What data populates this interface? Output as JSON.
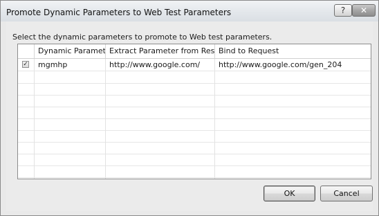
{
  "window": {
    "title": "Promote Dynamic Parameters to Web Test Parameters",
    "help_icon": "?",
    "close_icon": "✕"
  },
  "instruction": "Select the dynamic parameters to promote to Web test parameters.",
  "grid": {
    "columns": [
      "",
      "Dynamic Parameter",
      "Extract Parameter from Respo...",
      "Bind to Request"
    ],
    "rows": [
      {
        "checked": true,
        "check_glyph": "✓",
        "dynamic_parameter": "mgmhp",
        "extract_from": "http://www.google.com/",
        "bind_to": "http://www.google.com/gen_204"
      }
    ],
    "empty_row_count": 10
  },
  "buttons": {
    "ok": "OK",
    "cancel": "Cancel"
  }
}
